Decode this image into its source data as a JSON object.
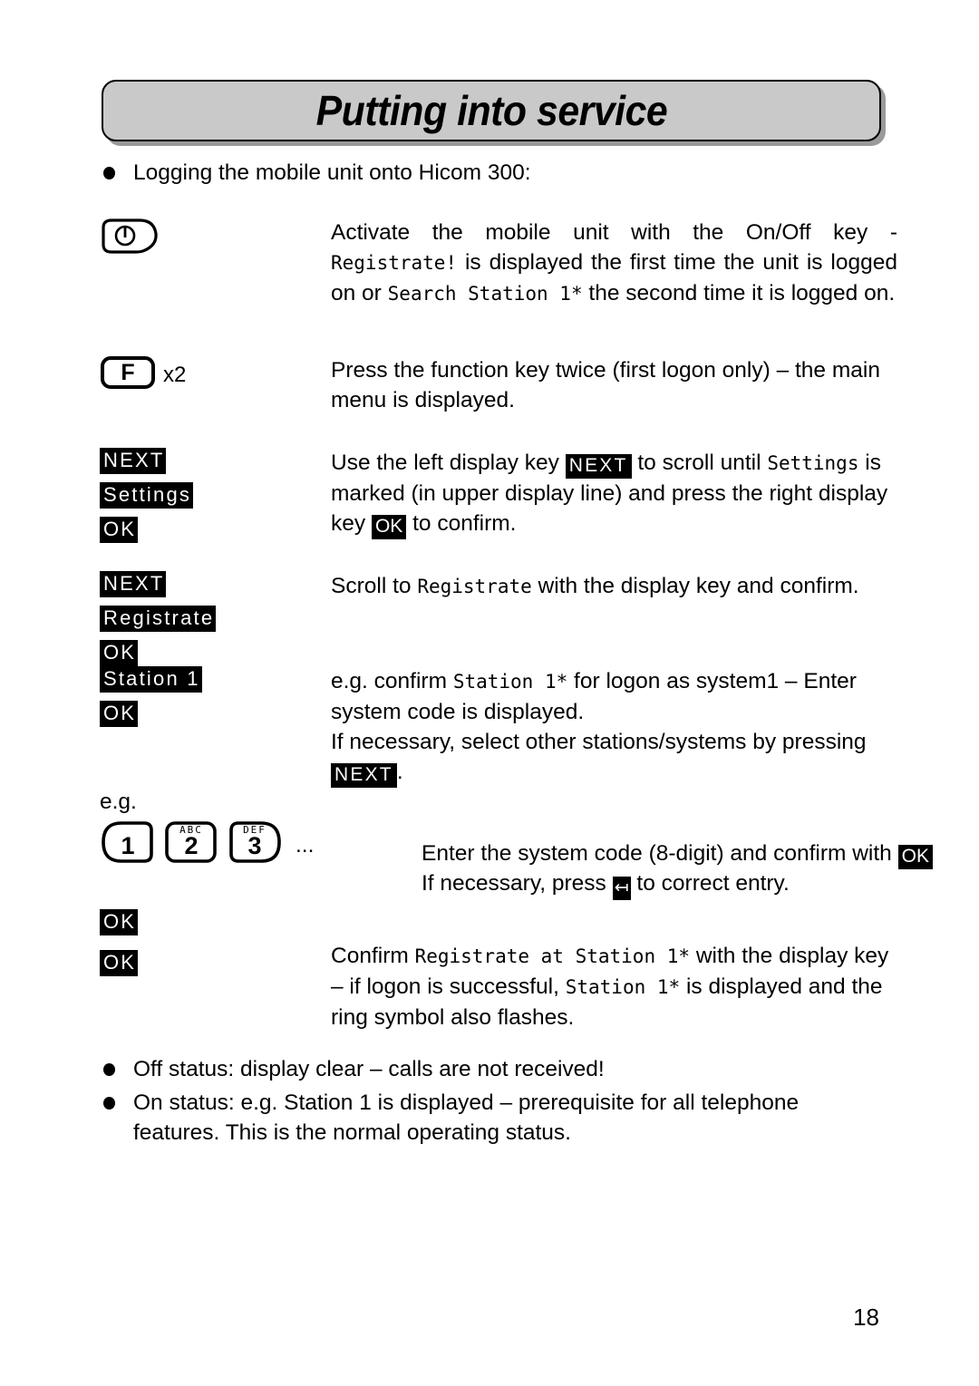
{
  "page": {
    "title": "Putting into service",
    "number": "18"
  },
  "intro_bullet": "Logging the mobile unit onto Hicom 300:",
  "steps": [
    {
      "id": "onoff",
      "key_icon": "power-on-off-key-icon",
      "text_parts": [
        {
          "type": "plain",
          "value": "Activate the mobile unit with the On/Off key - "
        },
        {
          "type": "lcd",
          "value": "Registrate!"
        },
        {
          "type": "plain",
          "value": " is displayed the first time the unit is logged on or "
        },
        {
          "type": "lcd",
          "value": "Search Station 1*"
        },
        {
          "type": "plain",
          "value": " the second time it is logged on."
        }
      ]
    },
    {
      "id": "function-key",
      "key_label": "F",
      "key_repeat": "x2",
      "text": "Press the function key twice (first logon only) – the main menu is displayed."
    },
    {
      "id": "settings",
      "chips": [
        "NEXT",
        "Settings",
        "OK"
      ],
      "text_parts": [
        {
          "type": "plain",
          "value": "Use the left display key "
        },
        {
          "type": "chip",
          "value": "NEXT"
        },
        {
          "type": "plain",
          "value": " to scroll until "
        },
        {
          "type": "lcd",
          "value": "Settings"
        },
        {
          "type": "plain",
          "value": " is marked (in upper display line) and press the right display key "
        },
        {
          "type": "chip",
          "value": "OK"
        },
        {
          "type": "plain",
          "value": " to confirm."
        }
      ]
    },
    {
      "id": "registrate",
      "chips": [
        "NEXT",
        "Registrate",
        "OK"
      ],
      "text_parts": [
        {
          "type": "plain",
          "value": "Scroll to "
        },
        {
          "type": "lcd",
          "value": "Registrate"
        },
        {
          "type": "plain",
          "value": " with the display key and confirm."
        }
      ]
    },
    {
      "id": "station-select",
      "chips": [
        "Station 1",
        "OK"
      ],
      "text_parts": [
        {
          "type": "plain",
          "value": "e.g. confirm "
        },
        {
          "type": "lcd",
          "value": "Station 1*"
        },
        {
          "type": "plain",
          "value": " for logon as system1 – Enter system code is displayed."
        }
      ],
      "text_parts_2": [
        {
          "type": "plain",
          "value": "If necessary, select other stations/systems by pressing "
        },
        {
          "type": "chip",
          "value": "NEXT"
        },
        {
          "type": "plain",
          "value": "."
        }
      ]
    },
    {
      "id": "system-code",
      "eg_label": "e.g.",
      "keys": [
        {
          "digit": "1",
          "letters": ""
        },
        {
          "digit": "2",
          "letters": "ABC"
        },
        {
          "digit": "3",
          "letters": "DEF"
        }
      ],
      "ellipsis": "...",
      "text_parts": [
        {
          "type": "plain",
          "value": "Enter the system code (8-digit) and confirm with "
        },
        {
          "type": "chip",
          "value": "OK"
        }
      ],
      "text_parts_2": [
        {
          "type": "plain",
          "value": "If necessary, press "
        },
        {
          "type": "icon",
          "value": "backspace-icon"
        },
        {
          "type": "plain",
          "value": " to correct entry."
        }
      ]
    },
    {
      "id": "confirm-logon",
      "chips": [
        "OK",
        "OK"
      ],
      "text_parts": [
        {
          "type": "plain",
          "value": "Confirm "
        },
        {
          "type": "lcd",
          "value": "Registrate at Station 1*"
        },
        {
          "type": "plain",
          "value": " with the display key – if logon is successful, "
        },
        {
          "type": "lcd",
          "value": "Station 1*"
        },
        {
          "type": "plain",
          "value": " is displayed and the ring symbol also flashes."
        }
      ]
    }
  ],
  "closing_bullets": [
    "Off status: display clear – calls are not received!",
    "On status: e.g. Station 1 is displayed – prerequisite for all telephone features. This is the normal operating status."
  ],
  "colors": {
    "banner_fill": "#c9c9c9",
    "banner_border": "#000000",
    "chip_bg": "#000000",
    "chip_fg": "#ffffff",
    "text": "#000000",
    "page_bg": "#ffffff"
  }
}
